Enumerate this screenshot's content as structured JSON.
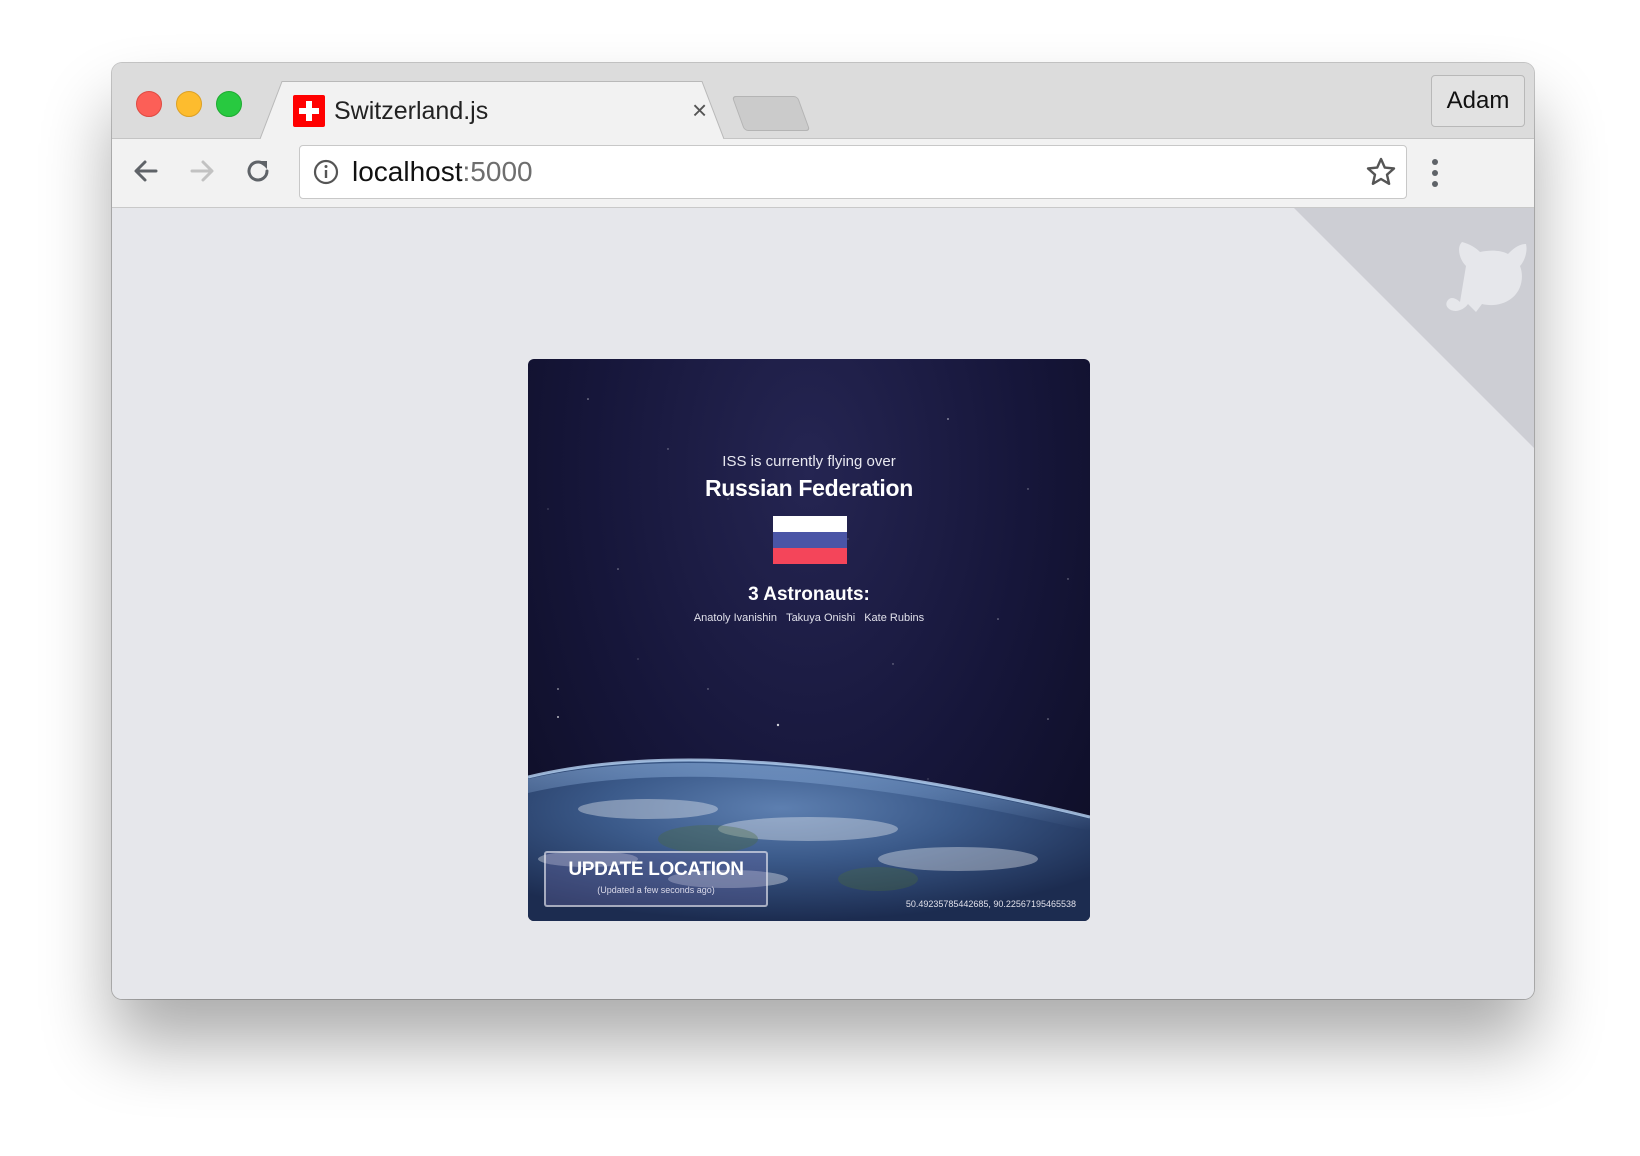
{
  "browser": {
    "tab": {
      "title": "Switzerland.js",
      "close_glyph": "×",
      "favicon": "swiss-flag-icon"
    },
    "profile_name": "Adam",
    "omnibox": {
      "host": "localhost",
      "port": ":5000"
    }
  },
  "card": {
    "subtitle": "ISS is currently flying over",
    "country": "Russian Federation",
    "flag_colors": [
      "#ffffff",
      "#4a55a6",
      "#f4455a"
    ],
    "astronauts_title": "3 Astronauts:",
    "astronauts": [
      "Anatoly Ivanishin",
      "Takuya Onishi",
      "Kate Rubins"
    ],
    "update_button": "UPDATE LOCATION",
    "updated_text": "(Updated a few seconds ago)",
    "coordinates": "50.49235785442685, 90.22567195465538"
  },
  "colors": {
    "page_bg": "#e6e7eb",
    "corner": "#cdced4",
    "card_bg": "#16163a"
  }
}
